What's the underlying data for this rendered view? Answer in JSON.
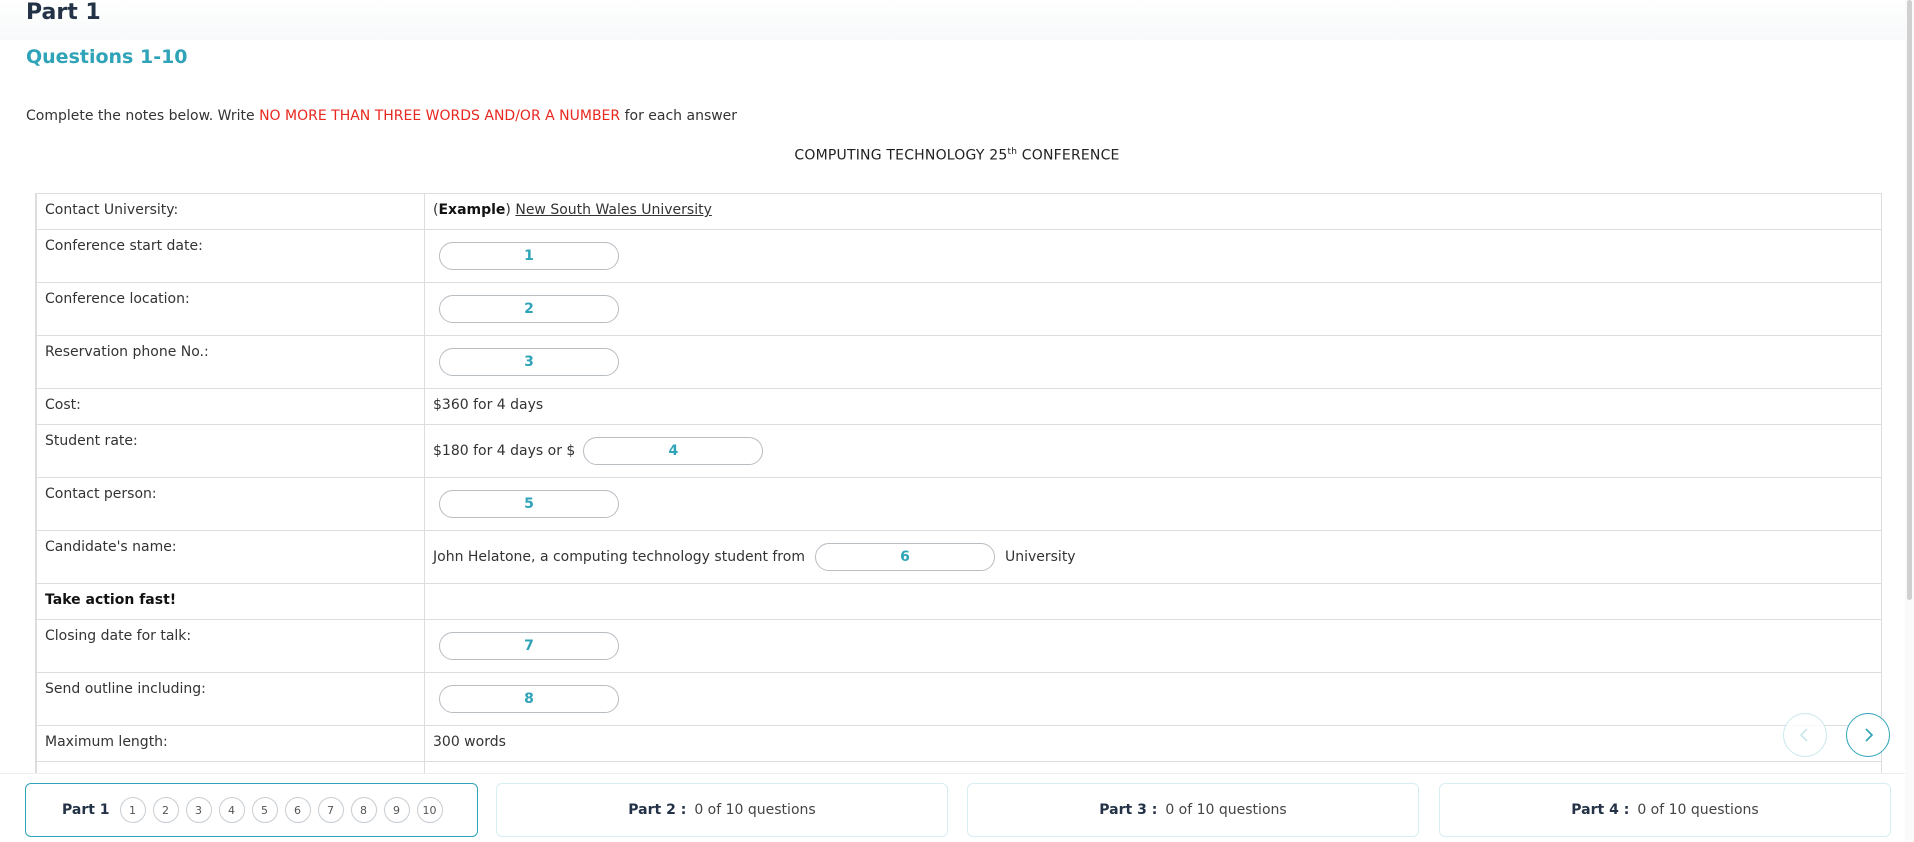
{
  "header": {
    "part_title": "Part 1",
    "question_range": "Questions 1-10"
  },
  "instructions": {
    "before": "Complete the notes below. Write ",
    "highlight": "NO MORE THAN THREE WORDS AND/OR A NUMBER",
    "after": " for each answer"
  },
  "conference_title": {
    "before": "COMPUTING TECHNOLOGY 25",
    "sup": "th",
    "after": " CONFERENCE"
  },
  "rows": {
    "contact_university": {
      "label": "Contact University:",
      "example_prefix": "(",
      "example_word": "Example",
      "example_suffix": ")",
      "example_value": "New South Wales University"
    },
    "start_date": {
      "label": "Conference start date:",
      "answer": "1"
    },
    "location": {
      "label": "Conference location:",
      "answer": "2"
    },
    "phone": {
      "label": "Reservation phone No.:",
      "answer": "3"
    },
    "cost": {
      "label": "Cost:",
      "value": "$360 for 4 days"
    },
    "student_rate": {
      "label": "Student rate:",
      "value_before": "$180 for 4 days or $",
      "answer": "4"
    },
    "contact_person": {
      "label": "Contact person:",
      "answer": "5"
    },
    "candidate": {
      "label": "Candidate's name:",
      "value_before": "John Helatone, a computing technology student from",
      "answer": "6",
      "value_after": "University"
    },
    "take_action": {
      "label": "Take action fast!"
    },
    "closing_date": {
      "label": "Closing date for talk:",
      "answer": "7"
    },
    "outline": {
      "label": "Send outline including:",
      "answer": "8"
    },
    "max_length": {
      "label": "Maximum length:",
      "value": "300 words"
    }
  },
  "navigation": {
    "prev_icon": "chevron-left-icon",
    "next_icon": "chevron-right-icon"
  },
  "footer": {
    "part1": {
      "label": "Part 1",
      "questions": [
        "1",
        "2",
        "3",
        "4",
        "5",
        "6",
        "7",
        "8",
        "9",
        "10"
      ]
    },
    "part2": {
      "label": "Part 2 :",
      "status": "0 of 10 questions"
    },
    "part3": {
      "label": "Part 3 :",
      "status": "0 of 10 questions"
    },
    "part4": {
      "label": "Part 4 :",
      "status": "0 of 10 questions"
    }
  },
  "colors": {
    "accent": "#2fa3b7",
    "highlight_red": "#e8271f",
    "heading_dark": "#233246"
  }
}
